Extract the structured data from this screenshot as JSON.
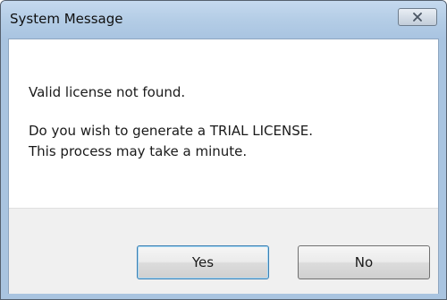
{
  "window": {
    "title": "System Message"
  },
  "message": {
    "line1": "Valid license not found.",
    "line2": "Do you wish to generate a TRIAL LICENSE.",
    "line3": "This process may take a minute."
  },
  "buttons": {
    "yes_label": "Yes",
    "no_label": "No"
  },
  "icons": {
    "close": "close-icon"
  },
  "colors": {
    "titlebar": "#b4cde6",
    "dialog_background": "#ffffff",
    "footer_background": "#f0f0f0",
    "default_button_border": "#3c7fb1"
  }
}
